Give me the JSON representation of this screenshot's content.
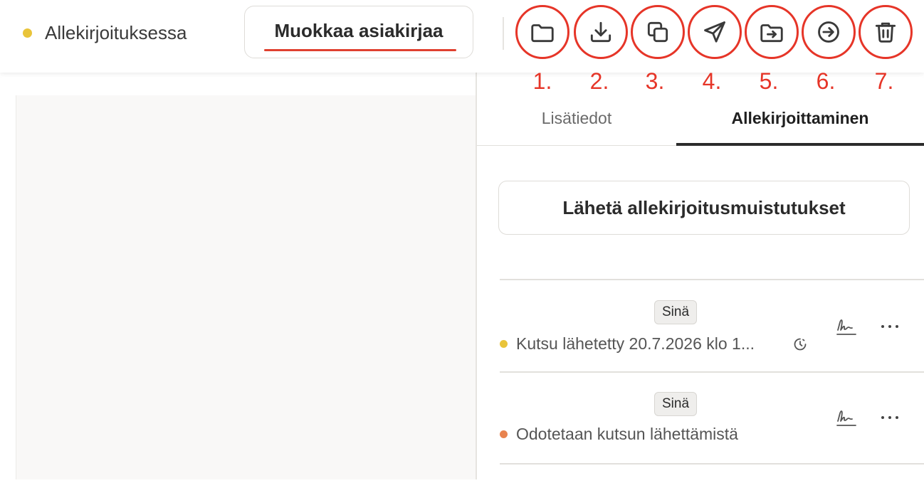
{
  "header": {
    "status_label": "Allekirjoituksessa",
    "status_color": "#e9c43a",
    "edit_button_label": "Muokkaa asiakirjaa",
    "annotation_color": "#e63528",
    "toolbar": [
      {
        "icon": "folder-icon",
        "number": "1."
      },
      {
        "icon": "download-icon",
        "number": "2."
      },
      {
        "icon": "copy-icon",
        "number": "3."
      },
      {
        "icon": "send-icon",
        "number": "4."
      },
      {
        "icon": "move-to-folder-icon",
        "number": "5."
      },
      {
        "icon": "arrow-in-circle-icon",
        "number": "6."
      },
      {
        "icon": "trash-icon",
        "number": "7."
      }
    ]
  },
  "panel": {
    "tabs": {
      "info": "Lisätiedot",
      "signing": "Allekirjoittaminen",
      "active": "signing"
    },
    "reminder_button": "Lähetä allekirjoitusmuistutukset",
    "signers": [
      {
        "badge": "Sinä",
        "status": "Kutsu lähetetty 20.7.2026 klo 1...",
        "status_color": "#e9c43a",
        "has_clock": true
      },
      {
        "badge": "Sinä",
        "status": "Odotetaan kutsun lähettämistä",
        "status_color": "#e8834f",
        "has_clock": false
      }
    ]
  }
}
